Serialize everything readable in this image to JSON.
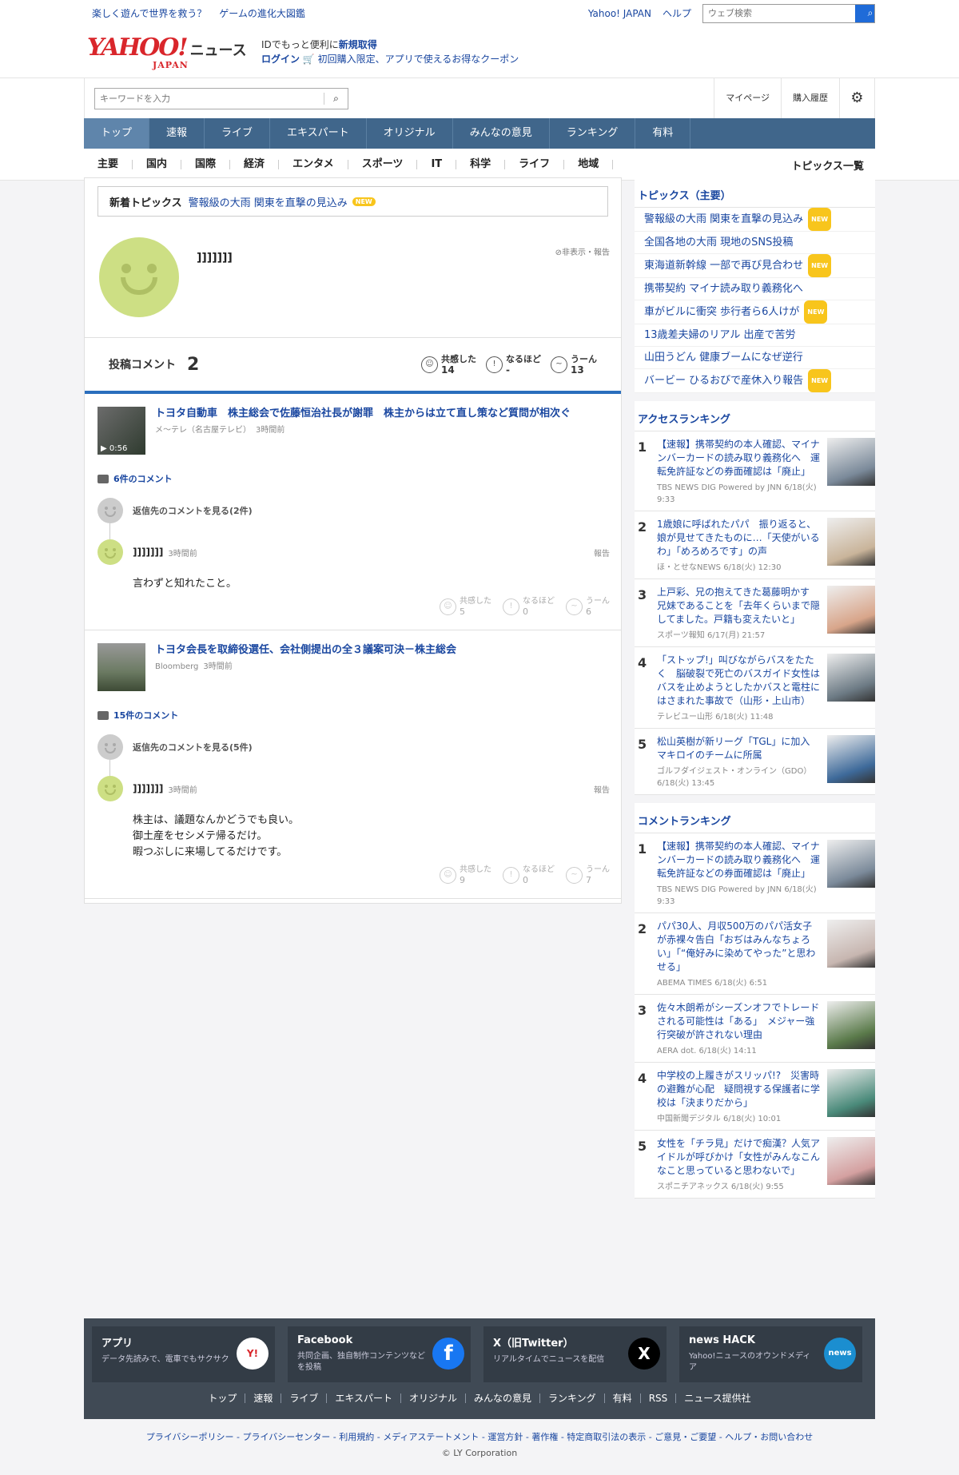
{
  "topbar": {
    "promo": [
      "楽しく遊んで世界を救う？",
      "ゲームの進化大図鑑"
    ],
    "yahoo_japan": "Yahoo! JAPAN",
    "help": "ヘルプ",
    "web_search_placeholder": "ウェブ検索"
  },
  "header": {
    "logo": "YAHOO!",
    "logo_japan": "JAPAN",
    "logo_news": "ニュース",
    "id_text": "IDでもっと便利に",
    "signup": "新規取得",
    "login": "ログイン",
    "coupon": "初回購入限定、アプリで使えるお得なクーポン"
  },
  "search": {
    "placeholder": "キーワードを入力",
    "mypage": "マイページ",
    "history": "購入履歴"
  },
  "mainnav": [
    "トップ",
    "速報",
    "ライブ",
    "エキスパート",
    "オリジナル",
    "みんなの意見",
    "ランキング",
    "有料"
  ],
  "subnav": [
    "主要",
    "国内",
    "国際",
    "経済",
    "エンタメ",
    "スポーツ",
    "IT",
    "科学",
    "ライフ",
    "地域"
  ],
  "subnav_all": "トピックス一覧",
  "newtopics": {
    "label": "新着トピックス",
    "link": "警報級の大雨 関東を直撃の見込み",
    "badge": "NEW"
  },
  "profile": {
    "name": "]]]]]]]",
    "hide": "非表示・報告"
  },
  "stats": {
    "label": "投稿コメント",
    "count": "2",
    "reacts": [
      {
        "label": "共感した",
        "value": "14"
      },
      {
        "label": "なるほど",
        "value": "-"
      },
      {
        "label": "うーん",
        "value": "13"
      }
    ]
  },
  "articles": [
    {
      "title": "トヨタ自動車　株主総会で佐藤恒治社長が謝罪　株主からは立て直し策など質問が相次ぐ",
      "source": "メ～テレ（名古屋テレビ）",
      "time": "3時間前",
      "duration": "▶ 0:56",
      "comments": "6件のコメント",
      "see_reply": "返信先のコメントを見る(2件)",
      "user": "]]]]]]]",
      "ctime": "3時間前",
      "report": "報告",
      "text": [
        "言わずと知れたこと。"
      ],
      "reacts": [
        {
          "label": "共感した",
          "value": "5"
        },
        {
          "label": "なるほど",
          "value": "0"
        },
        {
          "label": "うーん",
          "value": "6"
        }
      ]
    },
    {
      "title": "トヨタ会長を取締役選任、会社側提出の全３議案可決－株主総会",
      "source": "Bloomberg",
      "time": "3時間前",
      "comments": "15件のコメント",
      "see_reply": "返信先のコメントを見る(5件)",
      "user": "]]]]]]]",
      "ctime": "3時間前",
      "report": "報告",
      "text": [
        "株主は、議題なんかどうでも良い。",
        "御土産をセシメテ帰るだけ。",
        "暇つぶしに来場してるだけです。"
      ],
      "reacts": [
        {
          "label": "共感した",
          "value": "9"
        },
        {
          "label": "なるほど",
          "value": "0"
        },
        {
          "label": "うーん",
          "value": "7"
        }
      ]
    }
  ],
  "sidebar": {
    "topics_title": "トピックス（主要）",
    "topics": [
      {
        "text": "警報級の大雨 関東を直撃の見込み",
        "new": "NEW"
      },
      {
        "text": "全国各地の大雨 現地のSNS投稿",
        "new": ""
      },
      {
        "text": "東海道新幹線 一部で再び見合わせ",
        "new": "NEW"
      },
      {
        "text": "携帯契約 マイナ読み取り義務化へ",
        "new": ""
      },
      {
        "text": "車がビルに衝突 歩行者ら6人けが",
        "new": "NEW"
      },
      {
        "text": "13歳差夫婦のリアル 出産で苦労",
        "new": ""
      },
      {
        "text": "山田うどん 健康ブームになぜ逆行",
        "new": ""
      },
      {
        "text": "バービー ひるおびで産休入り報告",
        "new": "NEW"
      }
    ],
    "access_title": "アクセスランキング",
    "access": [
      {
        "num": "1",
        "title": "【速報】携帯契約の本人確認、マイナンバーカードの読み取り義務化へ　運転免許証などの券面確認は「廃止」",
        "src": "TBS NEWS DIG Powered by JNN 6/18(火) 9:33",
        "color": "#7b8a9a"
      },
      {
        "num": "2",
        "title": "1歳娘に呼ばれたパパ　振り返ると、娘が見せてきたものに…「天使がいるわ」「めろめろです」の声",
        "src": "ほ・とせなNEWS 6/18(火) 12:30",
        "color": "#c9b49a"
      },
      {
        "num": "3",
        "title": "上戸彩、兄の抱えてきた葛藤明かす　兄妹であることを「去年くらいまで隠してました。戸籍も変えたいと」",
        "src": "スポーツ報知 6/17(月) 21:57",
        "color": "#d8a58a"
      },
      {
        "num": "4",
        "title": "「ストップ!」叫びながらバスをたたく　脳破裂で死亡のバスガイド女性はバスを止めようとしたかバスと電柱にはさまれた事故で（山形・上山市）",
        "src": "テレビユー山形 6/18(火) 11:48",
        "color": "#6c7a84"
      },
      {
        "num": "5",
        "title": "松山英樹が新リーグ「TGL」に加入　マキロイのチームに所属",
        "src": "ゴルフダイジェスト・オンライン（GDO） 6/18(火) 13:45",
        "color": "#3e6a9a"
      }
    ],
    "comment_title": "コメントランキング",
    "comment": [
      {
        "num": "1",
        "title": "【速報】携帯契約の本人確認、マイナンバーカードの読み取り義務化へ　運転免許証などの券面確認は「廃止」",
        "src": "TBS NEWS DIG Powered by JNN 6/18(火) 9:33",
        "color": "#7b8a9a"
      },
      {
        "num": "2",
        "title": "パパ30人、月収500万のパパ活女子が赤裸々告白「おぢはみんなちょろい」「“俺好みに染めてやった”と思わせる」",
        "src": "ABEMA TIMES 6/18(火) 6:51",
        "color": "#c7b6b0"
      },
      {
        "num": "3",
        "title": "佐々木朗希がシーズンオフでトレードされる可能性は「ある」　メジャー強行突破が許されない理由",
        "src": "AERA dot. 6/18(火) 14:11",
        "color": "#5a7a4a"
      },
      {
        "num": "4",
        "title": "中学校の上履きがスリッパ!?　災害時の避難が心配　疑問視する保護者に学校は「決まりだから」",
        "src": "中国新聞デジタル 6/18(火) 10:01",
        "color": "#4a8a7a"
      },
      {
        "num": "5",
        "title": "女性を「チラ見」だけで痴漢？人気アイドルが呼びかけ「女性がみんなこんなこと思っていると思わないで」",
        "src": "スポニチアネックス 6/18(火) 9:55",
        "color": "#d4a0a0"
      }
    ]
  },
  "footer": {
    "cards": [
      {
        "title": "アプリ",
        "desc": "データ先読みで、電車でもサクサク",
        "icon": "Y!"
      },
      {
        "title": "Facebook",
        "desc": "共同企画、独自制作コンテンツなどを投稿",
        "icon": "f"
      },
      {
        "title": "X（旧Twitter）",
        "desc": "リアルタイムでニュースを配信",
        "icon": "X"
      },
      {
        "title": "news HACK",
        "desc": "Yahoo!ニュースのオウンドメディア",
        "icon": "news"
      }
    ],
    "links": [
      "トップ",
      "速報",
      "ライブ",
      "エキスパート",
      "オリジナル",
      "みんなの意見",
      "ランキング",
      "有料",
      "RSS",
      "ニュース提供社"
    ],
    "legal": "プライバシーポリシー - プライバシーセンター - 利用規約 - メディアステートメント - 運営方針 - 著作権 - 特定商取引法の表示 - ご意見・ご要望 - ヘルプ・お問い合わせ",
    "copyright": "© LY Corporation"
  },
  "colors": {
    "accent": "#1a47a0",
    "nav": "#40668b",
    "avatar": "#cddf84"
  }
}
